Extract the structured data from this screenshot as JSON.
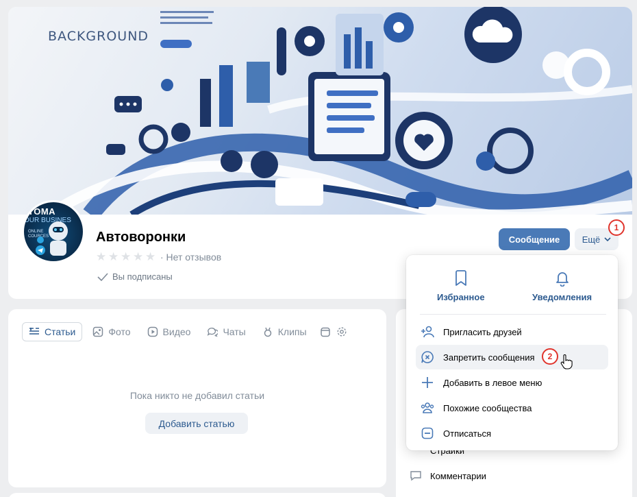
{
  "cover": {
    "title": "BACKGROUND"
  },
  "avatar": {
    "line1": "TOMA",
    "line2": "OUR BUSINES",
    "line3": "ONLINE COURCES"
  },
  "group": {
    "name": "Автоворонки",
    "rating": 0,
    "reviews_text": "· Нет отзывов",
    "subscribed_text": "Вы подписаны"
  },
  "actions": {
    "message_label": "Сообщение",
    "more_label": "Ещё"
  },
  "tabs": [
    {
      "label": "Статьи",
      "icon": "articles-icon",
      "active": true
    },
    {
      "label": "Фото",
      "icon": "photo-icon"
    },
    {
      "label": "Видео",
      "icon": "video-icon"
    },
    {
      "label": "Чаты",
      "icon": "chats-icon"
    },
    {
      "label": "Клипы",
      "icon": "clips-icon"
    }
  ],
  "content": {
    "empty_text": "Пока никто не добавил статьи",
    "add_button": "Добавить статью"
  },
  "sidebar": {
    "items": [
      {
        "label": "Страйки",
        "icon": "strike-icon"
      },
      {
        "label": "Комментарии",
        "icon": "comment-icon"
      }
    ]
  },
  "dropdown": {
    "top": [
      {
        "label": "Избранное",
        "icon": "bookmark-icon"
      },
      {
        "label": "Уведомления",
        "icon": "bell-icon"
      }
    ],
    "items": [
      {
        "label": "Пригласить друзей",
        "icon": "add-user-icon"
      },
      {
        "label": "Запретить сообщения",
        "icon": "block-message-icon",
        "hovered": true
      },
      {
        "label": "Добавить в левое меню",
        "icon": "plus-icon"
      },
      {
        "label": "Похожие сообщества",
        "icon": "communities-icon"
      },
      {
        "label": "Отписаться",
        "icon": "unsubscribe-icon"
      }
    ]
  },
  "markers": {
    "one": "1",
    "two": "2"
  },
  "colors": {
    "accent": "#4a7ab7",
    "link": "#2c5a8f",
    "marker": "#e0332b"
  }
}
